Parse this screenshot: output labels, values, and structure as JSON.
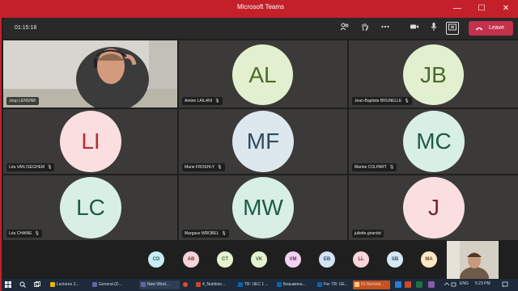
{
  "window": {
    "title": "Microsoft Teams",
    "minimize": "—",
    "maximize": "☐",
    "close": "✕"
  },
  "toolbar": {
    "timer": "01:15:18",
    "icons": [
      "participants-icon",
      "raise-hand-icon",
      "more-actions-icon",
      "camera-icon",
      "mic-icon",
      "share-screen-icon"
    ],
    "leave_label": "Leave"
  },
  "participants": [
    {
      "name": "Joop LENSINK",
      "initials": "",
      "video": true
    },
    {
      "name": "Amine LAILANI",
      "initials": "AL",
      "bg": "#e3f0d0",
      "fg": "#4a6b2a"
    },
    {
      "name": "Jean-Baptiste BRUNELLE",
      "initials": "JB",
      "bg": "#e3f0d0",
      "fg": "#4a6b2a"
    },
    {
      "name": "Léa VAN ISEGHEM",
      "initials": "LI",
      "bg": "#fbdfe0",
      "fg": "#b0303a"
    },
    {
      "name": "Marie FROEHLY",
      "initials": "MF",
      "bg": "#dde7ee",
      "fg": "#2f4c5e"
    },
    {
      "name": "Marine COLPART",
      "initials": "MC",
      "bg": "#d8efe6",
      "fg": "#1f5b46"
    },
    {
      "name": "Léa CHAINE",
      "initials": "LC",
      "bg": "#d8efe6",
      "fg": "#1f5b46"
    },
    {
      "name": "Margaux WROBEL",
      "initials": "MW",
      "bg": "#d8efe6",
      "fg": "#1f5b46"
    },
    {
      "name": "juliette.girardot",
      "initials": "J",
      "bg": "#fbdfe0",
      "fg": "#7a2030"
    }
  ],
  "overflow": [
    {
      "initials": "CD",
      "bg": "#c8ecf2",
      "fg": "#1f5f6b"
    },
    {
      "initials": "AB",
      "bg": "#f3d4d8",
      "fg": "#7a2f3a"
    },
    {
      "initials": "CT",
      "bg": "#e4f2d2",
      "fg": "#45652a"
    },
    {
      "initials": "VK",
      "bg": "#e4f2d2",
      "fg": "#45652a"
    },
    {
      "initials": "VM",
      "bg": "#f0d3ef",
      "fg": "#6b2a68"
    },
    {
      "initials": "EB",
      "bg": "#d4e4f4",
      "fg": "#2a4a6b"
    },
    {
      "initials": "LL",
      "bg": "#f8d6dc",
      "fg": "#7a2f3a"
    },
    {
      "initials": "SB",
      "bg": "#d4e8f4",
      "fg": "#2a4a6b"
    },
    {
      "initials": "MA",
      "bg": "#fbe8c8",
      "fg": "#6b4a1f"
    }
  ],
  "taskbar": {
    "items": [
      {
        "label": "Lectures 2...",
        "color": "#f0b400"
      },
      {
        "label": "General (D...",
        "color": "#6264a7"
      },
      {
        "label": "New Wind...",
        "color": "#6264a7"
      },
      {
        "label": "4_Nutrition...",
        "color": "#d24726"
      },
      {
        "label": "TR: UEC 1 ...",
        "color": "#0a64ad"
      },
      {
        "label": "Безымянн...",
        "color": "#0a64ad"
      },
      {
        "label": "Fw: TR: UE...",
        "color": "#0a64ad"
      },
      {
        "label": "61 Remind...",
        "color": "#d24726"
      }
    ],
    "lang": "ENG",
    "time": "5:23 PM"
  }
}
